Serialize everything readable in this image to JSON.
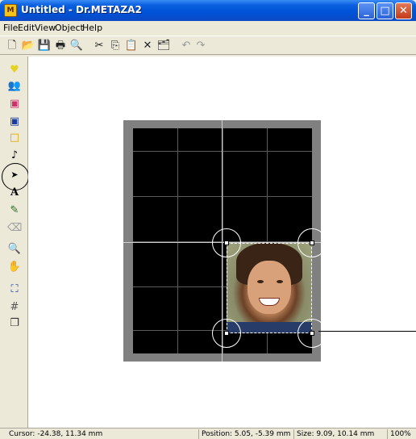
{
  "window": {
    "app_icon_text": "M",
    "title": "Untitled - Dr.METAZA2",
    "minimize_glyph": "_",
    "maximize_glyph": "□",
    "close_glyph": "✕"
  },
  "menu": [
    "File",
    "Edit",
    "View",
    "Object",
    "Help"
  ],
  "toolbar": {
    "icons": [
      {
        "name": "new-icon",
        "glyph": "🗋"
      },
      {
        "name": "open-icon",
        "glyph": "📂"
      },
      {
        "name": "save-icon",
        "glyph": "💾"
      },
      {
        "name": "print-icon",
        "glyph": "🖶"
      },
      {
        "name": "print-preview-icon",
        "glyph": "🔍"
      },
      {
        "name": "cut-icon",
        "glyph": "✂"
      },
      {
        "name": "copy-icon",
        "glyph": "⎘"
      },
      {
        "name": "paste-icon",
        "glyph": "📋"
      },
      {
        "name": "delete-icon",
        "glyph": "✕"
      },
      {
        "name": "properties-icon",
        "glyph": "🗂"
      },
      {
        "name": "undo-icon",
        "glyph": "↶"
      },
      {
        "name": "redo-icon",
        "glyph": "↷"
      }
    ]
  },
  "left_toolbar": [
    {
      "name": "heart-icon",
      "glyph": "♥",
      "color": "#e6d220"
    },
    {
      "name": "people-icon",
      "glyph": "👥",
      "color": "#2a8a2a"
    },
    {
      "name": "portrait-icon",
      "glyph": "▣",
      "color": "#d0306a"
    },
    {
      "name": "portrait-frame-icon",
      "glyph": "▣",
      "color": "#1a3aa0"
    },
    {
      "name": "rectangle-icon",
      "glyph": "□",
      "color": "#d8a800"
    },
    {
      "name": "music-note-icon",
      "glyph": "♪",
      "color": "#000000"
    },
    {
      "name": "select-arrow-icon",
      "glyph": "➤",
      "color": "#000000"
    },
    {
      "name": "text-tool-icon",
      "glyph": "A",
      "color": "#000000"
    },
    {
      "name": "pen-tool-icon",
      "glyph": "✎",
      "color": "#2a6a2a"
    },
    {
      "name": "eraser-icon",
      "glyph": "⌫",
      "color": "#999999"
    },
    {
      "name": "zoom-icon",
      "glyph": "🔍",
      "color": "#1a5aa0"
    },
    {
      "name": "hand-pan-icon",
      "glyph": "✋",
      "color": "#c08a20"
    },
    {
      "name": "fit-view-icon",
      "glyph": "⛶",
      "color": "#1a3aa0"
    },
    {
      "name": "grid-icon",
      "glyph": "#",
      "color": "#555555"
    },
    {
      "name": "layers-icon",
      "glyph": "❐",
      "color": "#333333"
    }
  ],
  "status": {
    "cursor": "Cursor: -24.38, 11.34 mm",
    "position": "Position: 5.05, -5.39 mm",
    "size": "Size: 9.09, 10.14 mm",
    "zoom": "100%"
  }
}
